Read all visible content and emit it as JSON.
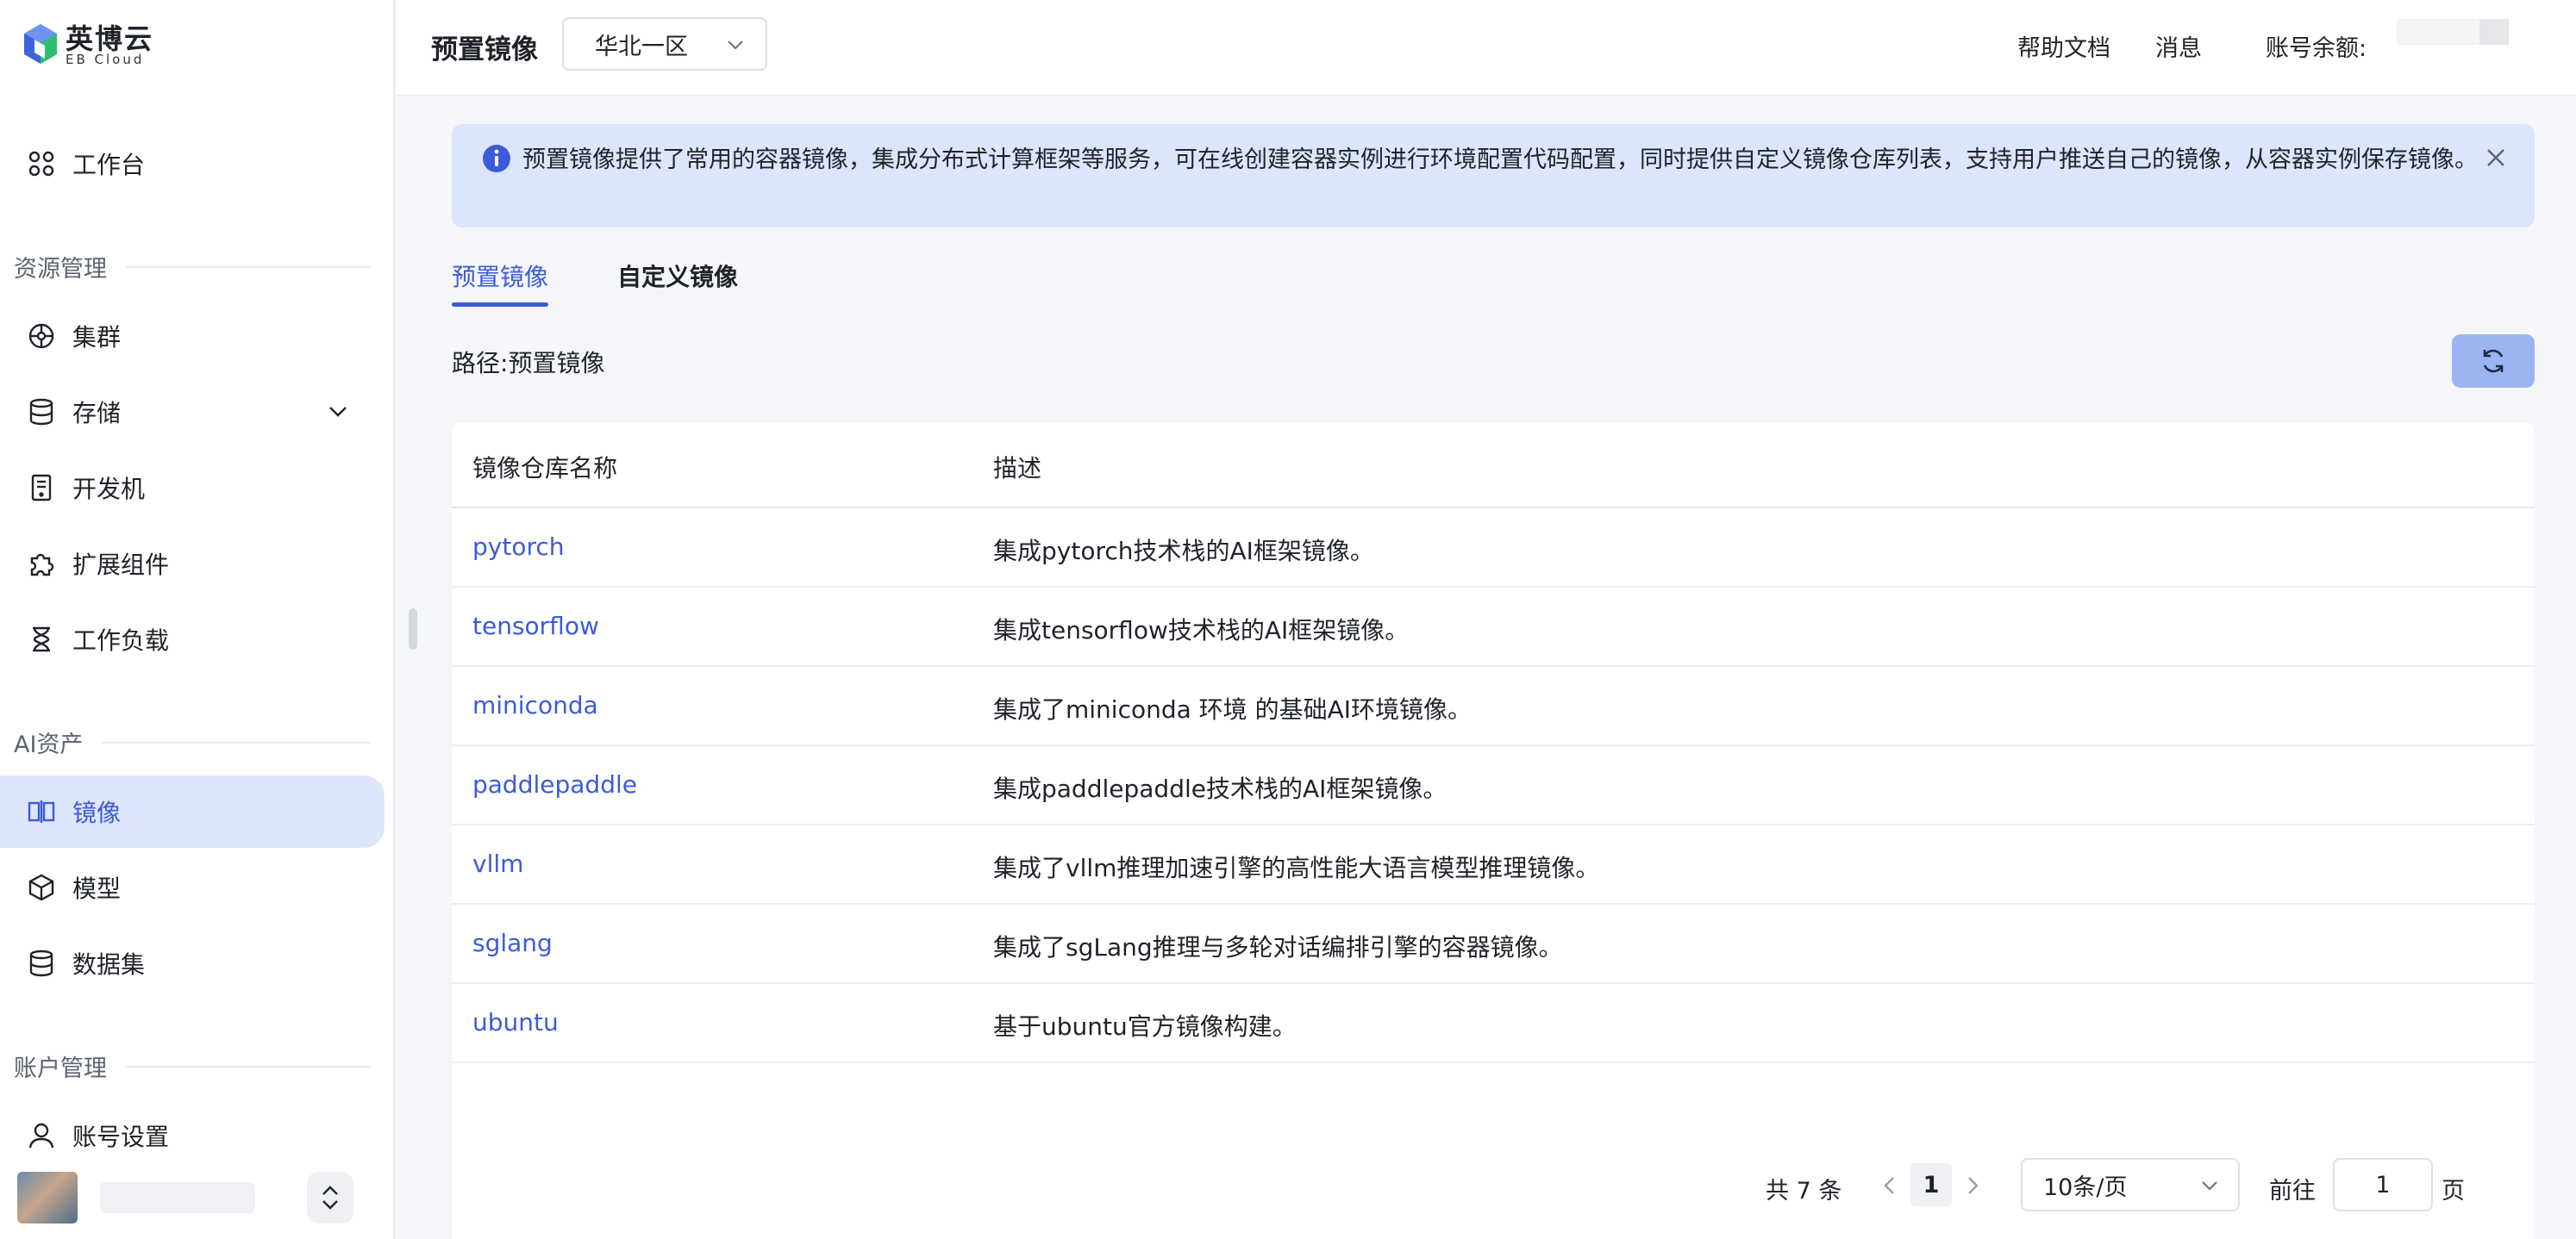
{
  "brand": {
    "name_cn": "英博云",
    "name_en": "EB Cloud"
  },
  "sidebar": {
    "workbench": "工作台",
    "groups": {
      "resource": "资源管理",
      "ai_assets": "AI资产",
      "account": "账户管理"
    },
    "items": {
      "cluster": "集群",
      "storage": "存储",
      "devbox": "开发机",
      "extensions": "扩展组件",
      "workload": "工作负载",
      "image": "镜像",
      "model": "模型",
      "dataset": "数据集",
      "account_settings": "账号设置"
    },
    "active": "image"
  },
  "header": {
    "title": "预置镜像",
    "region": "华北一区",
    "help_docs": "帮助文档",
    "messages": "消息",
    "balance_label": "账号余额:"
  },
  "alert": {
    "text": "预置镜像提供了常用的容器镜像，集成分布式计算框架等服务，可在线创建容器实例进行环境配置代码配置，同时提供自定义镜像仓库列表，支持用户推送自己的镜像，从容器实例保存镜像。"
  },
  "tabs": {
    "preset": "预置镜像",
    "custom": "自定义镜像"
  },
  "path": {
    "label": "路径:",
    "value": "预置镜像"
  },
  "table": {
    "columns": {
      "name": "镜像仓库名称",
      "desc": "描述"
    },
    "rows": [
      {
        "name": "pytorch",
        "desc": "集成pytorch技术栈的AI框架镜像。"
      },
      {
        "name": "tensorflow",
        "desc": "集成tensorflow技术栈的AI框架镜像。"
      },
      {
        "name": "miniconda",
        "desc": "集成了miniconda 环境 的基础AI环境镜像。"
      },
      {
        "name": "paddlepaddle",
        "desc": "集成paddlepaddle技术栈的AI框架镜像。"
      },
      {
        "name": "vllm",
        "desc": "集成了vllm推理加速引擎的高性能大语言模型推理镜像。"
      },
      {
        "name": "sglang",
        "desc": "集成了sgLang推理与多轮对话编排引擎的容器镜像。"
      },
      {
        "name": "ubuntu",
        "desc": "基于ubuntu官方镜像构建。"
      }
    ]
  },
  "pagination": {
    "total": "共 7 条",
    "current": "1",
    "page_size": "10条/页",
    "goto_label": "前往",
    "goto_value": "1",
    "page_suffix": "页"
  },
  "colors": {
    "accent": "#3c5bd9",
    "active_bg": "#dde6fb",
    "alert_bg": "#dbe5fb",
    "refresh_bg": "#9db4f2"
  }
}
